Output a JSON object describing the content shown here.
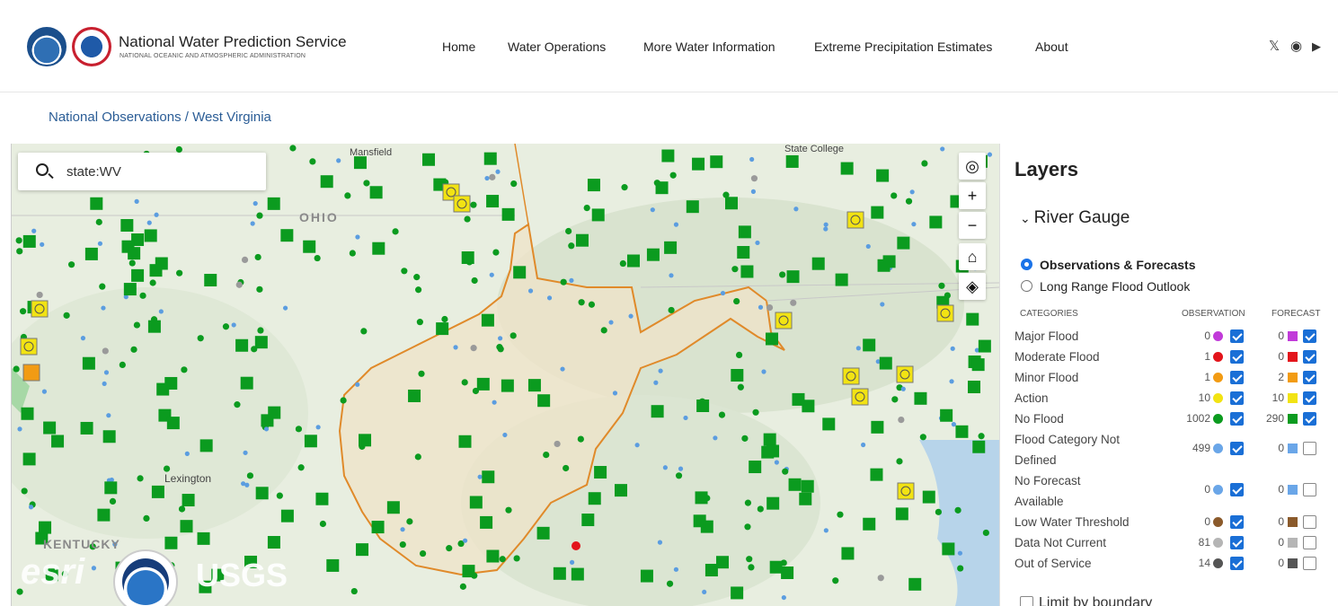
{
  "header": {
    "title": "National Water Prediction Service",
    "subtitle": "NATIONAL OCEANIC AND ATMOSPHERIC ADMINISTRATION",
    "nav": [
      "Home",
      "Water Operations",
      "More Water Information",
      "Extreme Precipitation Estimates",
      "About"
    ],
    "social": {
      "x": "𝕏",
      "github": "◉",
      "youtube": "▶"
    }
  },
  "breadcrumb": "National Observations / West Virginia",
  "search": {
    "value": "state:WV"
  },
  "map": {
    "labels": {
      "mansfield": "Mansfield",
      "state_college": "State College",
      "ohio": "OHIO",
      "lexington": "Lexington",
      "kentucky": "KENTUCKY"
    },
    "logos": {
      "esri": "esri",
      "usgs": "USGS",
      "noaa": "NOAA"
    }
  },
  "layers": {
    "title": "Layers",
    "group": "River Gauge",
    "radio_options": [
      {
        "label": "Observations & Forecasts",
        "selected": true
      },
      {
        "label": "Long Range Flood Outlook",
        "selected": false
      }
    ],
    "columns": {
      "category": "CATEGORIES",
      "observation": "OBSERVATION",
      "forecast": "FORECAST"
    },
    "categories": [
      {
        "label": "Major Flood",
        "obs": "0",
        "fc": "0",
        "color": "#c13bd9",
        "obs_on": true,
        "fc_on": true
      },
      {
        "label": "Moderate Flood",
        "obs": "1",
        "fc": "0",
        "color": "#e3141b",
        "obs_on": true,
        "fc_on": true
      },
      {
        "label": "Minor Flood",
        "obs": "1",
        "fc": "2",
        "color": "#f29b13",
        "obs_on": true,
        "fc_on": true
      },
      {
        "label": "Action",
        "obs": "10",
        "fc": "10",
        "color": "#f2e313",
        "obs_on": true,
        "fc_on": true
      },
      {
        "label": "No Flood",
        "obs": "1002",
        "fc": "290",
        "color": "#0b9b1f",
        "obs_on": true,
        "fc_on": true
      },
      {
        "label": "Flood Category Not",
        "label2": "Defined",
        "obs": "499",
        "fc": "0",
        "color": "#6aa6e8",
        "obs_on": true,
        "fc_on": false
      },
      {
        "label": "No Forecast",
        "label2": "Available",
        "obs": "0",
        "fc": "0",
        "color": "#6aa6e8",
        "obs_on": true,
        "fc_on": false
      },
      {
        "label": "Low Water Threshold",
        "obs": "0",
        "fc": "0",
        "color": "#8b5a2b",
        "obs_on": true,
        "fc_on": false
      },
      {
        "label": "Data Not Current",
        "obs": "81",
        "fc": "0",
        "color": "#b5b5b5",
        "obs_on": true,
        "fc_on": false
      },
      {
        "label": "Out of Service",
        "obs": "14",
        "fc": "0",
        "color": "#555555",
        "obs_on": true,
        "fc_on": false
      }
    ],
    "limit_label": "Limit by boundary"
  }
}
